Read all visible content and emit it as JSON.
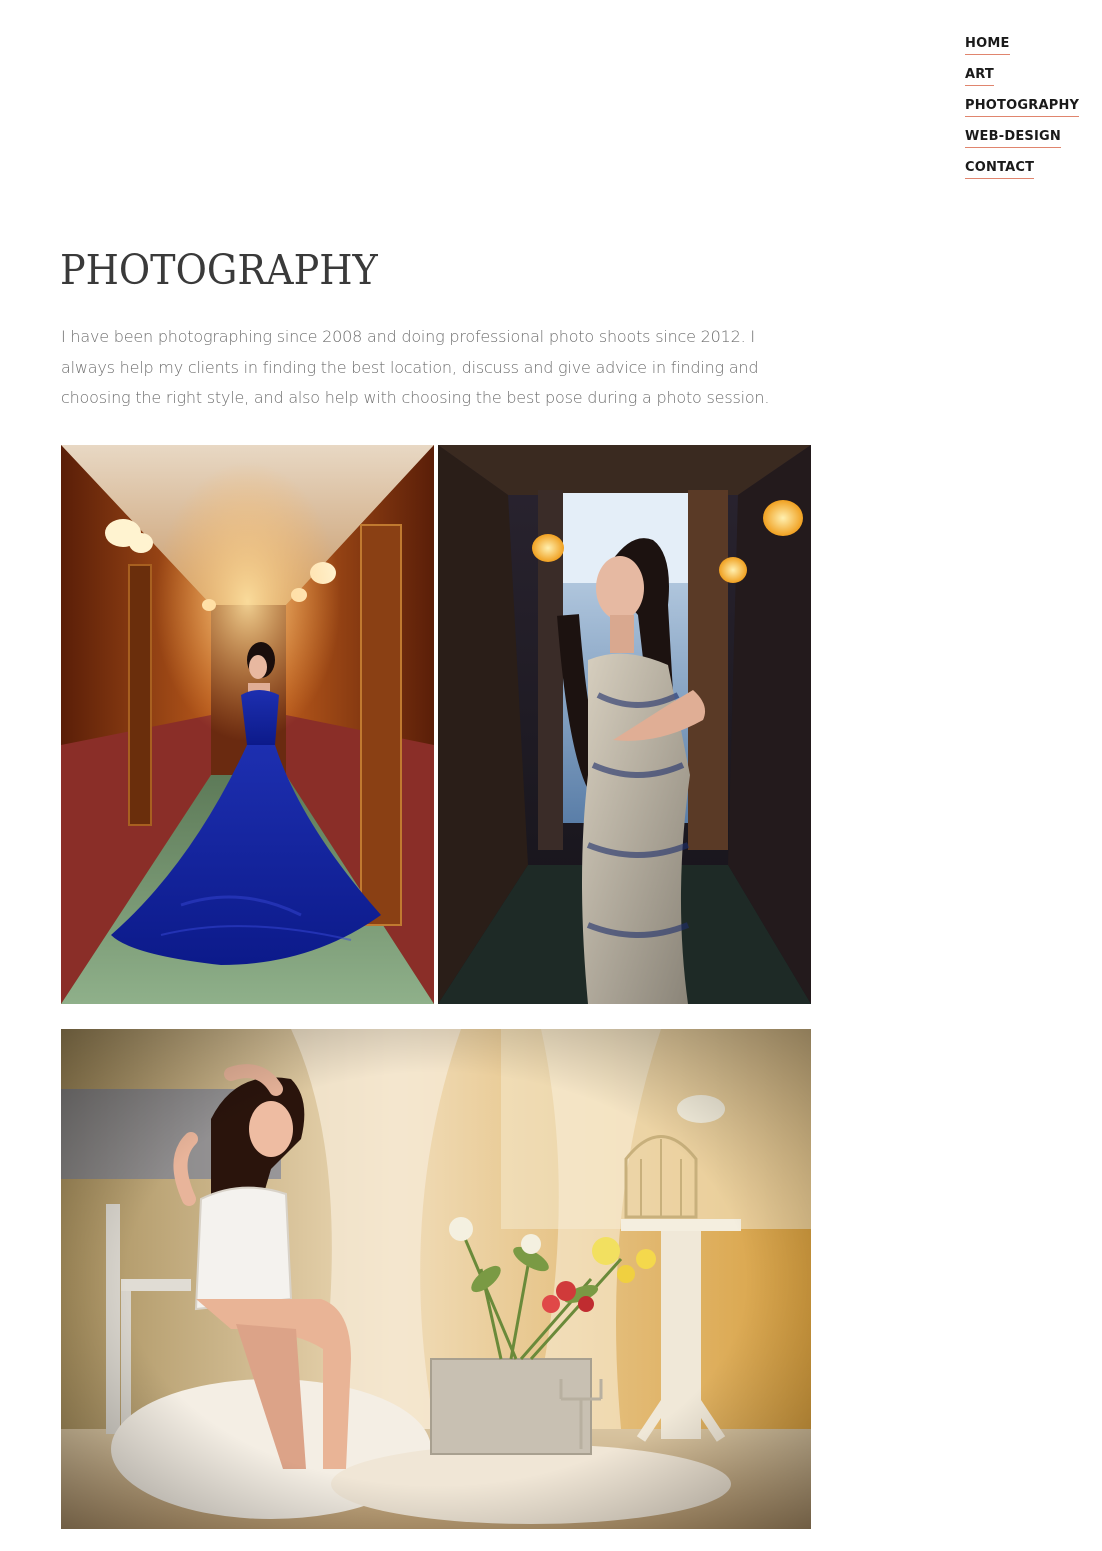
{
  "nav": {
    "items": [
      {
        "label": "HOME"
      },
      {
        "label": "ART"
      },
      {
        "label": "PHOTOGRAPHY"
      },
      {
        "label": "WEB-DESIGN"
      },
      {
        "label": "CONTACT"
      }
    ]
  },
  "page": {
    "title": "PHOTOGRAPHY",
    "intro": "I have been photographing since 2008 and doing professional photo shoots since 2012. I always help my clients in finding the best location, discuss and give advice in finding and choosing the right style, and also help with choosing the best pose during a photo session."
  },
  "gallery": {
    "photos": [
      {
        "subject": "woman in blue gown in hotel corridor"
      },
      {
        "subject": "woman in patterned dress in dim hallway"
      },
      {
        "subject": "woman in white corset on fur-covered chair beside birdcage and flowers"
      }
    ]
  }
}
